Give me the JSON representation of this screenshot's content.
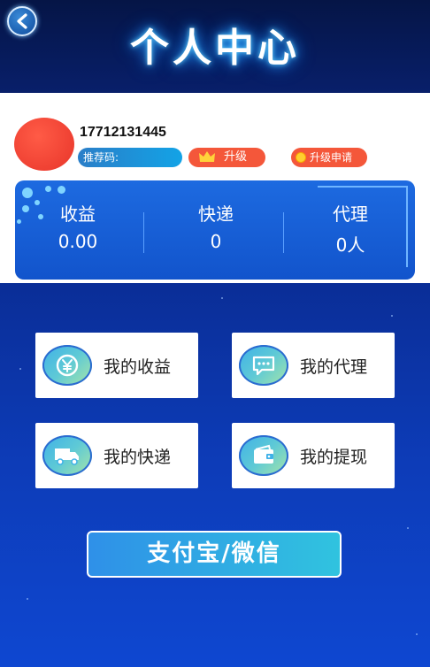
{
  "header": {
    "title": "个人中心"
  },
  "profile": {
    "phone": "17712131445",
    "referral_label": "推荐码:",
    "upgrade_label": "升级",
    "apply_upgrade_label": "升级申请"
  },
  "stats": [
    {
      "label": "收益",
      "value": "0.00"
    },
    {
      "label": "快递",
      "value": "0"
    },
    {
      "label": "代理",
      "value": "0人"
    }
  ],
  "menu": [
    {
      "label": "我的收益",
      "icon": "yuan-coin-icon"
    },
    {
      "label": "我的代理",
      "icon": "chat-bubble-icon"
    },
    {
      "label": "我的快递",
      "icon": "delivery-truck-icon"
    },
    {
      "label": "我的提现",
      "icon": "wallet-icon"
    }
  ],
  "pay_button": {
    "label": "支付宝/微信"
  },
  "colors": {
    "accent_red": "#f4573a",
    "brand_blue": "#1254cc",
    "pay_gradient_end": "#30c3df"
  }
}
